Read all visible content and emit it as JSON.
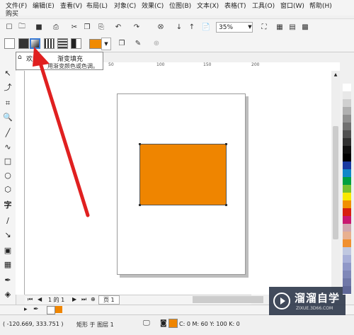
{
  "menu": {
    "items": [
      "文件(F)",
      "编辑(E)",
      "查看(V)",
      "布局(L)",
      "对象(C)",
      "效果(C)",
      "位图(B)",
      "文本(X)",
      "表格(T)",
      "工具(O)",
      "窗口(W)",
      "帮助(H)"
    ],
    "row2": "购买"
  },
  "toolbar": {
    "zoom": "35%"
  },
  "tooltip": {
    "tab": "欢迎",
    "title": "渐变填充",
    "desc": "用渐变颜色或色调。"
  },
  "ruler": {
    "ticks": [
      "50",
      "100",
      "150",
      "200"
    ]
  },
  "colors": {
    "fill": "#ef8500"
  },
  "palette": [
    "#ffffff",
    "#e8e8e8",
    "#d0d0d0",
    "#b0b0b0",
    "#909090",
    "#707070",
    "#505050",
    "#303030",
    "#101010",
    "#000000",
    "#1a3aa0",
    "#1088c8",
    "#00a040",
    "#78c030",
    "#f8e800",
    "#f09000",
    "#d82010",
    "#c81870",
    "#d0a8b0",
    "#e8b090",
    "#f09030",
    "#c0c8e0",
    "#a8b0d8",
    "#9098c8",
    "#8088b8",
    "#7078a8",
    "#606898"
  ],
  "nav": {
    "page_info": "1 的 1",
    "page_tab": "页 1"
  },
  "status": {
    "coords": "( -120.669, 333.751 )",
    "object": "矩形 于 图层 1",
    "color": "C: 0 M: 60 Y: 100 K: 0"
  },
  "watermark": {
    "title": "溜溜自学",
    "url": "ZIXUE.3D66.COM"
  }
}
